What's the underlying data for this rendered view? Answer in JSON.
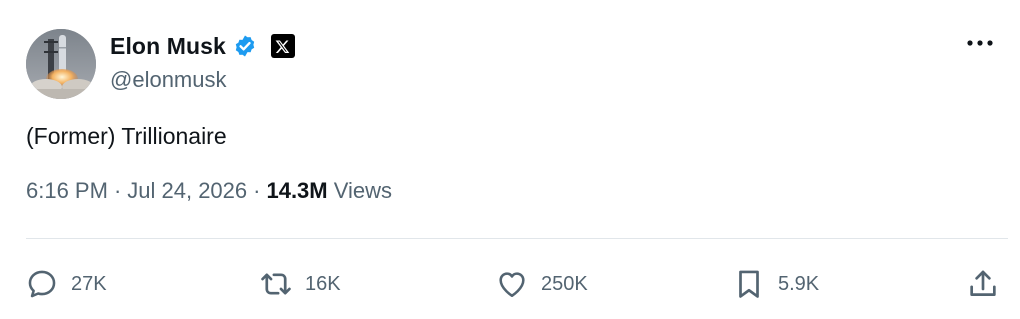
{
  "author": {
    "name": "Elon Musk",
    "handle": "@elonmusk",
    "verified": true,
    "affiliation_badge": "x-logo-icon",
    "avatar": "rocket-launch-avatar"
  },
  "tweet": {
    "text": "(Former) Trillionaire"
  },
  "meta": {
    "time": "6:16 PM",
    "separator": "·",
    "date": "Jul 24, 2026",
    "views_count": "14.3M",
    "views_label": "Views"
  },
  "actions": {
    "reply": {
      "icon": "reply-icon",
      "count": "27K"
    },
    "retweet": {
      "icon": "retweet-icon",
      "count": "16K"
    },
    "like": {
      "icon": "heart-icon",
      "count": "250K"
    },
    "bookmark": {
      "icon": "bookmark-icon",
      "count": "5.9K"
    },
    "share": {
      "icon": "share-icon"
    }
  },
  "colors": {
    "text_primary": "#0f1419",
    "text_secondary": "#536471",
    "verified_blue": "#1d9bf0",
    "divider": "#e1e6ea"
  }
}
